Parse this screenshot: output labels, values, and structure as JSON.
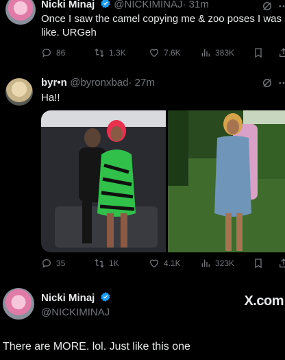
{
  "tweet1": {
    "name": "Nicki Minaj",
    "handle": "@NICKIMINAJ",
    "time": "· 31m",
    "text": "Once I saw the camel copying me & zoo poses I was like. URGeh",
    "replies": "86",
    "reposts": "1.3K",
    "likes": "7.6K",
    "views": "383K"
  },
  "tweet2": {
    "name": "byr•n",
    "handle": "@byronxbad",
    "time": "· 27m",
    "text": "Ha!!",
    "replies": "35",
    "reposts": "1K",
    "likes": "4.1K",
    "views": "323K"
  },
  "card": {
    "name": "Nicki Minaj",
    "handle": "@NICKIMINAJ",
    "brand": "X.com",
    "text": "There are MORE. lol. Just like this one"
  },
  "colors": {
    "background": "#000000",
    "text": "#e7e9ea",
    "muted": "#71767b",
    "verified": "#1d9bf0"
  },
  "icons": [
    "reply-icon",
    "repost-icon",
    "like-icon",
    "views-icon",
    "bookmark-icon",
    "share-icon",
    "grok-icon",
    "more-icon",
    "verified-badge-icon"
  ]
}
